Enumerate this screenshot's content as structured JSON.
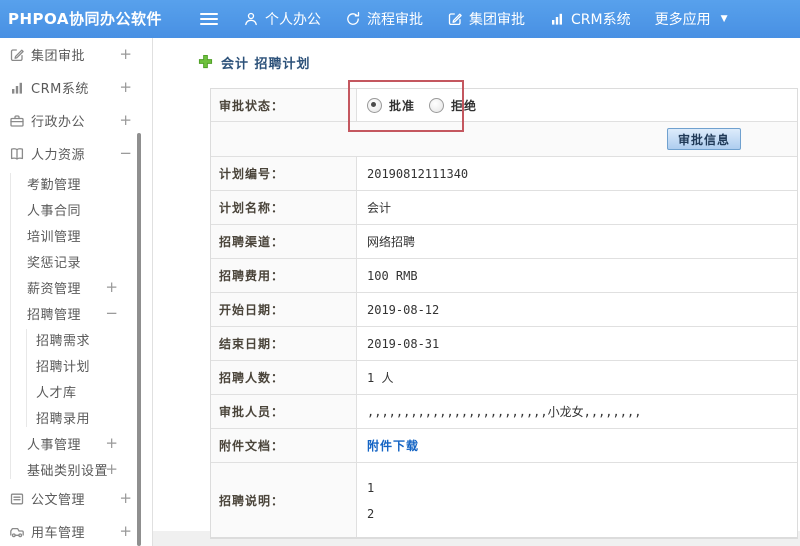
{
  "colors": {
    "topbar_blue": "#4890e3",
    "annotation_red": "#c4575f",
    "link_blue": "#1464c4",
    "button_border": "#70a1cf"
  },
  "topbar": {
    "logo": "PHPOA协同办公软件",
    "nav": [
      {
        "label": "个人办公",
        "icon": "person-icon"
      },
      {
        "label": "流程审批",
        "icon": "cycle-icon"
      },
      {
        "label": "集团审批",
        "icon": "edit-icon"
      },
      {
        "label": "CRM系统",
        "icon": "chart-icon"
      },
      {
        "label": "更多应用",
        "icon": "caret-down-icon",
        "caret": true
      }
    ]
  },
  "sidebar": {
    "items": [
      {
        "label": "集团审批",
        "icon": "edit-icon",
        "toggle": "+"
      },
      {
        "label": "CRM系统",
        "icon": "chart-icon",
        "toggle": "+"
      },
      {
        "label": "行政办公",
        "icon": "briefcase-icon",
        "toggle": "+"
      },
      {
        "label": "人力资源",
        "icon": "book-icon",
        "toggle": "-",
        "children": [
          {
            "label": "考勤管理"
          },
          {
            "label": "人事合同"
          },
          {
            "label": "培训管理"
          },
          {
            "label": "奖惩记录"
          },
          {
            "label": "薪资管理",
            "toggle": "+"
          },
          {
            "label": "招聘管理",
            "toggle": "-",
            "children": [
              {
                "label": "招聘需求"
              },
              {
                "label": "招聘计划"
              },
              {
                "label": "人才库"
              },
              {
                "label": "招聘录用"
              }
            ]
          },
          {
            "label": "人事管理",
            "toggle": "+"
          },
          {
            "label": "基础类别设置",
            "toggle": "+"
          }
        ]
      },
      {
        "label": "公文管理",
        "icon": "doc-icon",
        "toggle": "+"
      },
      {
        "label": "用车管理",
        "icon": "car-icon",
        "toggle": "+"
      }
    ]
  },
  "main": {
    "title": "会计 招聘计划",
    "title_icon": "plus-icon",
    "approval": {
      "label": "审批状态：",
      "options": [
        {
          "label": "批准",
          "checked": true
        },
        {
          "label": "拒绝",
          "checked": false
        }
      ],
      "button_label": "审批信息"
    },
    "form_rows": [
      {
        "label": "计划编号：",
        "value": "20190812111340"
      },
      {
        "label": "计划名称：",
        "value": "会计"
      },
      {
        "label": "招聘渠道：",
        "value": "网络招聘"
      },
      {
        "label": "招聘费用：",
        "value": "100 RMB"
      },
      {
        "label": "开始日期：",
        "value": "2019-08-12"
      },
      {
        "label": "结束日期：",
        "value": "2019-08-31"
      },
      {
        "label": "招聘人数：",
        "value": "1 人"
      },
      {
        "label": "审批人员：",
        "value": ",,,,,,,,,,,,,,,,,,,,,,,,,小龙女,,,,,,,,"
      },
      {
        "label": "附件文档：",
        "value": "附件下载",
        "link": true
      },
      {
        "label": "招聘说明：",
        "value": "1\n2",
        "multiline": true
      }
    ]
  }
}
